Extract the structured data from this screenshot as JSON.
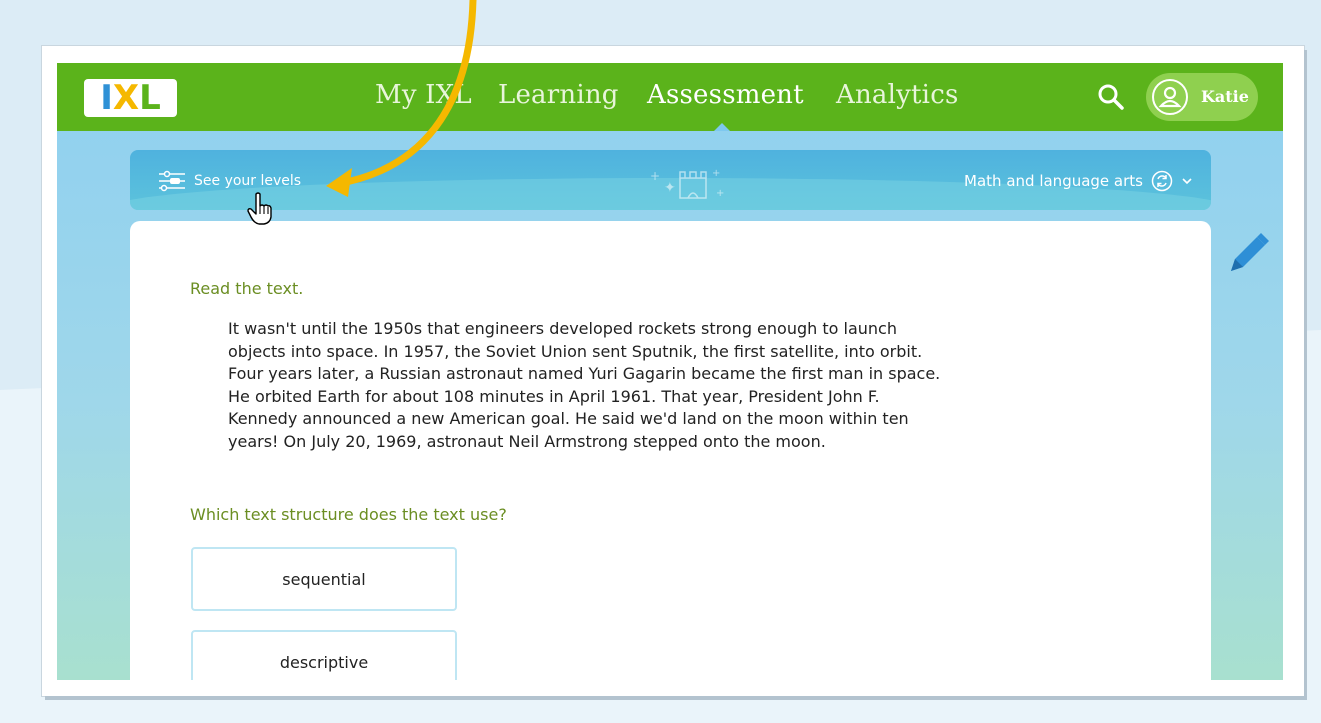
{
  "nav": {
    "logo_text": "IXL",
    "items": [
      {
        "label": "My IXL",
        "active": false
      },
      {
        "label": "Learning",
        "active": false
      },
      {
        "label": "Assessment",
        "active": true
      },
      {
        "label": "Analytics",
        "active": false
      }
    ],
    "search_icon": "search-icon",
    "user_name": "Katie"
  },
  "levels_bar": {
    "see_levels_label": "See your levels",
    "subject_label": "Math and language arts"
  },
  "question": {
    "instruction": "Read the text.",
    "passage_lines": [
      "It wasn't until the 1950s that engineers developed rockets strong enough to launch",
      "objects into space. In 1957, the Soviet Union sent Sputnik, the first satellite, into orbit.",
      "Four years later, a Russian astronaut named Yuri Gagarin became the first man in space.",
      "He orbited Earth for about 108 minutes in April 1961. That year, President John F.",
      "Kennedy announced a new American goal. He said we'd land on the moon within ten",
      "years! On July 20, 1969, astronaut Neil Armstrong stepped onto the moon."
    ],
    "prompt": "Which text structure does the text use?",
    "choices": [
      "sequential",
      "descriptive"
    ]
  },
  "colors": {
    "nav_green": "#5bb31b",
    "instruction_green": "#6b8e23",
    "annotation_arrow": "#f5b800"
  }
}
